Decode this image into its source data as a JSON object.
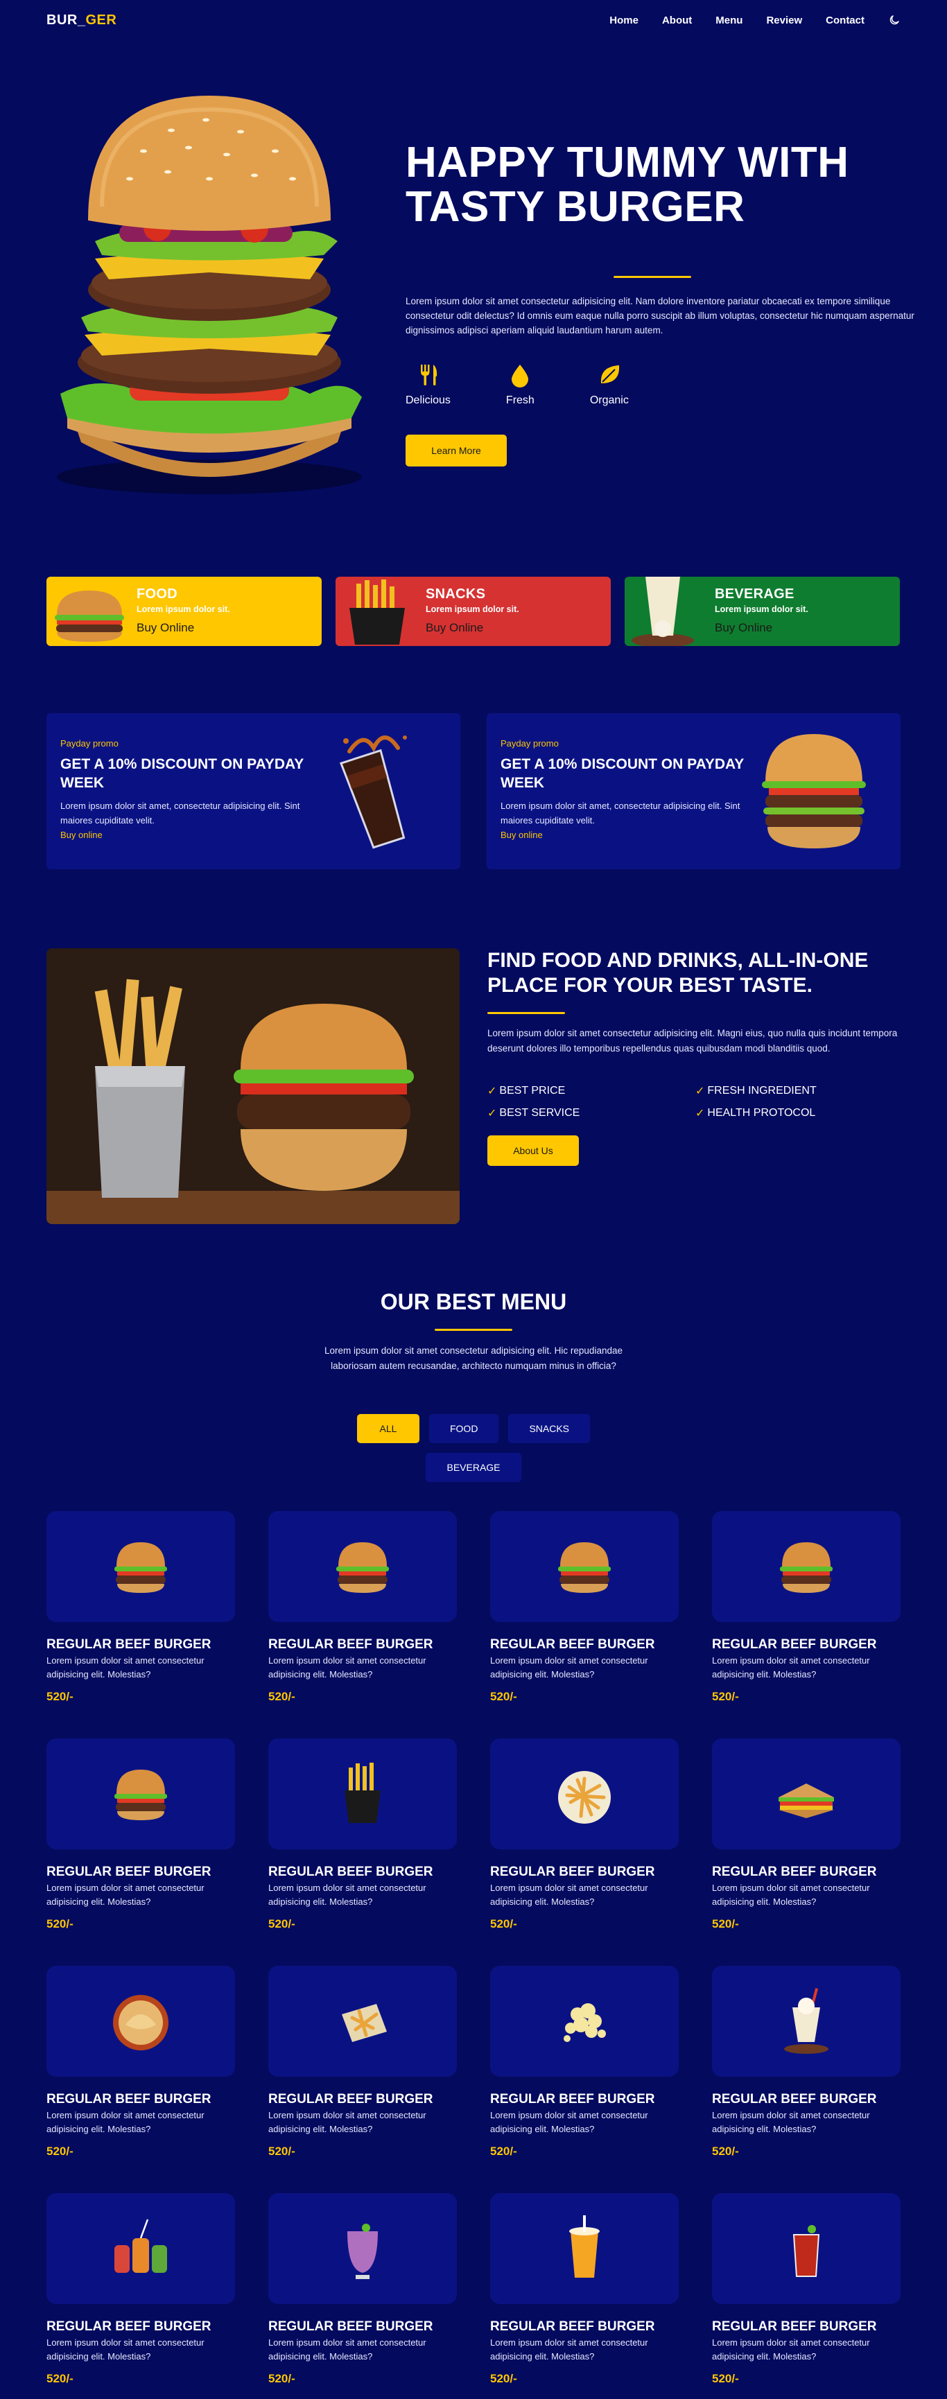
{
  "nav": {
    "logo_main": "BUR_",
    "logo_accent": "GER",
    "links": [
      "Home",
      "About",
      "Menu",
      "Review",
      "Contact"
    ]
  },
  "hero": {
    "title": "HAPPY TUMMY WITH TASTY BURGER",
    "description": "Lorem ipsum dolor sit amet consectetur adipisicing elit. Nam dolore inventore pariatur obcaecati ex tempore similique consectetur odit delectus? Id omnis eum eaque nulla porro suscipit ab illum voluptas, consectetur hic numquam aspernatur dignissimos adipisci aperiam aliquid laudantium harum autem.",
    "features": [
      "Delicious",
      "Fresh",
      "Organic"
    ],
    "button": "Learn More"
  },
  "categories": [
    {
      "title": "FOOD",
      "subtitle": "Lorem ipsum dolor sit.",
      "link": "Buy Online",
      "color": "#ffc700"
    },
    {
      "title": "SNACKS",
      "subtitle": "Lorem ipsum dolor sit.",
      "link": "Buy Online",
      "color": "#d63232"
    },
    {
      "title": "BEVERAGE",
      "subtitle": "Lorem ipsum dolor sit.",
      "link": "Buy Online",
      "color": "#0f7d2f"
    }
  ],
  "promos": [
    {
      "tag": "Payday promo",
      "title": "GET A 10% DISCOUNT ON PAYDAY WEEK",
      "description": "Lorem ipsum dolor sit amet, consectetur adipisicing elit. Sint maiores cupiditate velit.",
      "link": "Buy online"
    },
    {
      "tag": "Payday promo",
      "title": "GET A 10% DISCOUNT ON PAYDAY WEEK",
      "description": "Lorem ipsum dolor sit amet, consectetur adipisicing elit. Sint maiores cupiditate velit.",
      "link": "Buy online"
    }
  ],
  "about": {
    "title": "FIND FOOD AND DRINKS, ALL-IN-ONE PLACE FOR YOUR BEST TASTE.",
    "description": "Lorem ipsum dolor sit amet consectetur adipisicing elit. Magni eius, quo nulla quis incidunt tempora deserunt dolores illo temporibus repellendus quas quibusdam modi blanditiis quod.",
    "checks": [
      "BEST PRICE",
      "FRESH INGREDIENT",
      "BEST SERVICE",
      "HEALTH PROTOCOL"
    ],
    "button": "About Us"
  },
  "menu": {
    "title": "OUR BEST MENU",
    "description": "Lorem ipsum dolor sit amet consectetur adipisicing elit. Hic repudiandae laboriosam autem recusandae, architecto numquam minus in officia?",
    "filters": [
      "ALL",
      "FOOD",
      "SNACKS",
      "BEVERAGE"
    ],
    "items": [
      {
        "name": "REGULAR BEEF BURGER",
        "desc": "Lorem ipsum dolor sit amet consectetur adipisicing elit. Molestias?",
        "price": "520/-",
        "icon": "burger-icon"
      },
      {
        "name": "REGULAR BEEF BURGER",
        "desc": "Lorem ipsum dolor sit amet consectetur adipisicing elit. Molestias?",
        "price": "520/-",
        "icon": "burger-icon"
      },
      {
        "name": "REGULAR BEEF BURGER",
        "desc": "Lorem ipsum dolor sit amet consectetur adipisicing elit. Molestias?",
        "price": "520/-",
        "icon": "burger-icon"
      },
      {
        "name": "REGULAR BEEF BURGER",
        "desc": "Lorem ipsum dolor sit amet consectetur adipisicing elit. Molestias?",
        "price": "520/-",
        "icon": "burger-icon"
      },
      {
        "name": "REGULAR BEEF BURGER",
        "desc": "Lorem ipsum dolor sit amet consectetur adipisicing elit. Molestias?",
        "price": "520/-",
        "icon": "burger-icon"
      },
      {
        "name": "REGULAR BEEF BURGER",
        "desc": "Lorem ipsum dolor sit amet consectetur adipisicing elit. Molestias?",
        "price": "520/-",
        "icon": "fries-bucket-icon"
      },
      {
        "name": "REGULAR BEEF BURGER",
        "desc": "Lorem ipsum dolor sit amet consectetur adipisicing elit. Molestias?",
        "price": "520/-",
        "icon": "fries-plate-icon"
      },
      {
        "name": "REGULAR BEEF BURGER",
        "desc": "Lorem ipsum dolor sit amet consectetur adipisicing elit. Molestias?",
        "price": "520/-",
        "icon": "sandwich-icon"
      },
      {
        "name": "REGULAR BEEF BURGER",
        "desc": "Lorem ipsum dolor sit amet consectetur adipisicing elit. Molestias?",
        "price": "520/-",
        "icon": "dumpling-bowl-icon"
      },
      {
        "name": "REGULAR BEEF BURGER",
        "desc": "Lorem ipsum dolor sit amet consectetur adipisicing elit. Molestias?",
        "price": "520/-",
        "icon": "fries-paper-icon"
      },
      {
        "name": "REGULAR BEEF BURGER",
        "desc": "Lorem ipsum dolor sit amet consectetur adipisicing elit. Molestias?",
        "price": "520/-",
        "icon": "popcorn-icon"
      },
      {
        "name": "REGULAR BEEF BURGER",
        "desc": "Lorem ipsum dolor sit amet consectetur adipisicing elit. Molestias?",
        "price": "520/-",
        "icon": "milkshake-icon"
      },
      {
        "name": "REGULAR BEEF BURGER",
        "desc": "Lorem ipsum dolor sit amet consectetur adipisicing elit. Molestias?",
        "price": "520/-",
        "icon": "jar-drinks-icon"
      },
      {
        "name": "REGULAR BEEF BURGER",
        "desc": "Lorem ipsum dolor sit amet consectetur adipisicing elit. Molestias?",
        "price": "520/-",
        "icon": "smoothie-icon"
      },
      {
        "name": "REGULAR BEEF BURGER",
        "desc": "Lorem ipsum dolor sit amet consectetur adipisicing elit. Molestias?",
        "price": "520/-",
        "icon": "orange-drink-icon"
      },
      {
        "name": "REGULAR BEEF BURGER",
        "desc": "Lorem ipsum dolor sit amet consectetur adipisicing elit. Molestias?",
        "price": "520/-",
        "icon": "red-drink-icon"
      }
    ]
  },
  "colors": {
    "background": "#040a5e",
    "card": "#0a1283",
    "accent": "#ffc700"
  }
}
